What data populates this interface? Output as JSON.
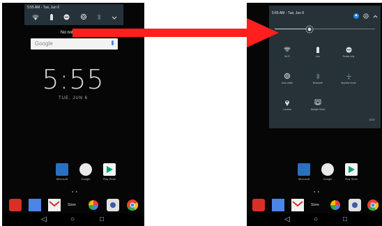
{
  "left_screen": {
    "notification_shade": {
      "status": "5:55 AM - Tue, Jun 6"
    },
    "no_notifications_text": "No noti",
    "search": {
      "placeholder": "Google"
    },
    "clock": {
      "time": "5:55",
      "date": "TUE, JUN 6"
    },
    "apps": [
      {
        "label": "Microsoft"
      },
      {
        "label": "Google"
      },
      {
        "label": "Play Store"
      }
    ],
    "dock_label": "Store"
  },
  "right_screen": {
    "quick_settings": {
      "status": "5:55 AM - Tue, Jun 6",
      "brightness": 0.35,
      "tiles": [
        {
          "label": "Wi-Fi"
        },
        {
          "label": "Info"
        },
        {
          "label": "Rotate only"
        },
        {
          "label": "Auto-rotate"
        },
        {
          "label": "Bluetooth"
        },
        {
          "label": "Airplane mode"
        },
        {
          "label": "Location"
        },
        {
          "label": "Multiple Sleek"
        }
      ],
      "edit_label": "EDIT"
    },
    "apps": [
      {
        "label": "Microsoft"
      },
      {
        "label": "Google"
      },
      {
        "label": "Play Store"
      }
    ],
    "dock_label": "Store"
  },
  "colors": {
    "shade": "#263238",
    "arrow": "#ff1f1f",
    "accent_blue": "#4a86e8"
  },
  "icons": [
    "wifi-icon",
    "battery-icon",
    "do-not-disturb-icon",
    "auto-rotate-icon",
    "bluetooth-icon",
    "chevron-icon",
    "brightness-icon",
    "user-icon",
    "gear-icon",
    "location-icon",
    "back-icon",
    "home-icon",
    "recents-icon"
  ]
}
